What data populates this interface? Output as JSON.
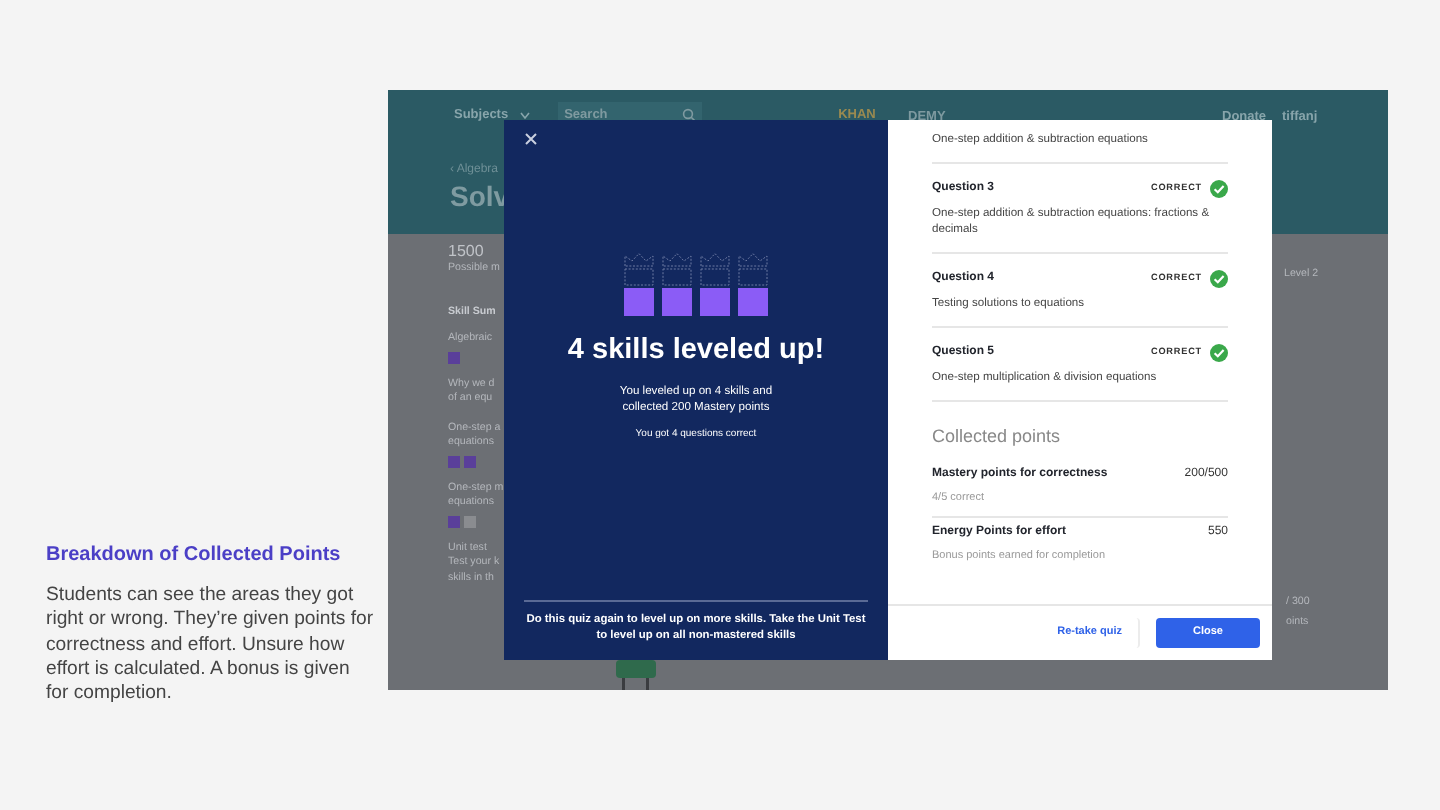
{
  "slide": {
    "title": "Breakdown of Collected Points",
    "body": "Students can see the areas they got right or wrong. They’re given points for correctness and effort. Unsure how effort is calculated. A bonus is given for completion."
  },
  "background_page": {
    "nav_left": "Subjects",
    "search_placeholder": "Search",
    "logo_left": "KHAN",
    "logo_right": "DEMY",
    "nav_right": [
      "Donate",
      "tiffanj"
    ],
    "breadcrumb": "‹ Algebra",
    "title": "Solv",
    "points": "1500",
    "points_caption": "Possible m",
    "skills_heading": "Skill Sum",
    "skills": [
      {
        "lines": [
          "Algebraic"
        ],
        "squares": [
          {
            "filled": true
          }
        ]
      },
      {
        "lines": [
          "Why we d",
          "of an equ"
        ]
      },
      {
        "lines": [
          "One-step a",
          "equations"
        ],
        "squares": [
          {
            "filled": true
          },
          {
            "filled": true
          }
        ]
      },
      {
        "lines": [
          "One-step m",
          "equations"
        ],
        "squares": [
          {
            "filled": true
          },
          {
            "filled": false
          }
        ]
      },
      {
        "lines": [
          "Unit test",
          "Test your k",
          "skills in th"
        ]
      }
    ],
    "side_texts": [
      "Level 2",
      "/ 300",
      "oints"
    ]
  },
  "modal": {
    "summary": {
      "skills": [
        {
          "leveled_up": true
        },
        {
          "leveled_up": true
        },
        {
          "leveled_up": true
        },
        {
          "leveled_up": true
        }
      ],
      "headline": "4 skills leveled up!",
      "message": "You leveled up on 4 skills and collected 200 Mastery points",
      "correct_note": "You got 4 questions correct",
      "footer_note": "Do this quiz again to level up on more skills. Take the Unit Test to level up on all non-mastered skills"
    },
    "questions": [
      {
        "description": "One-step addition & subtraction equations"
      },
      {
        "title": "Question 3",
        "status": "CORRECT",
        "correct": true,
        "description": "One-step addition & subtraction equations: fractions & decimals"
      },
      {
        "title": "Question 4",
        "status": "CORRECT",
        "correct": true,
        "description": "Testing solutions to equations"
      },
      {
        "title": "Question 5",
        "status": "CORRECT",
        "correct": true,
        "description": "One-step multiplication & division equations"
      }
    ],
    "collected": {
      "heading": "Collected points",
      "rows": [
        {
          "label": "Mastery points for correctness",
          "value": "200/500",
          "note": "4/5 correct"
        },
        {
          "label": "Energy Points for effort",
          "value": "550",
          "note": "Bonus points earned for completion"
        }
      ]
    },
    "buttons": [
      {
        "label": "Re-take quiz",
        "kind": "link"
      },
      {
        "label": "Close",
        "kind": "primary"
      }
    ]
  }
}
